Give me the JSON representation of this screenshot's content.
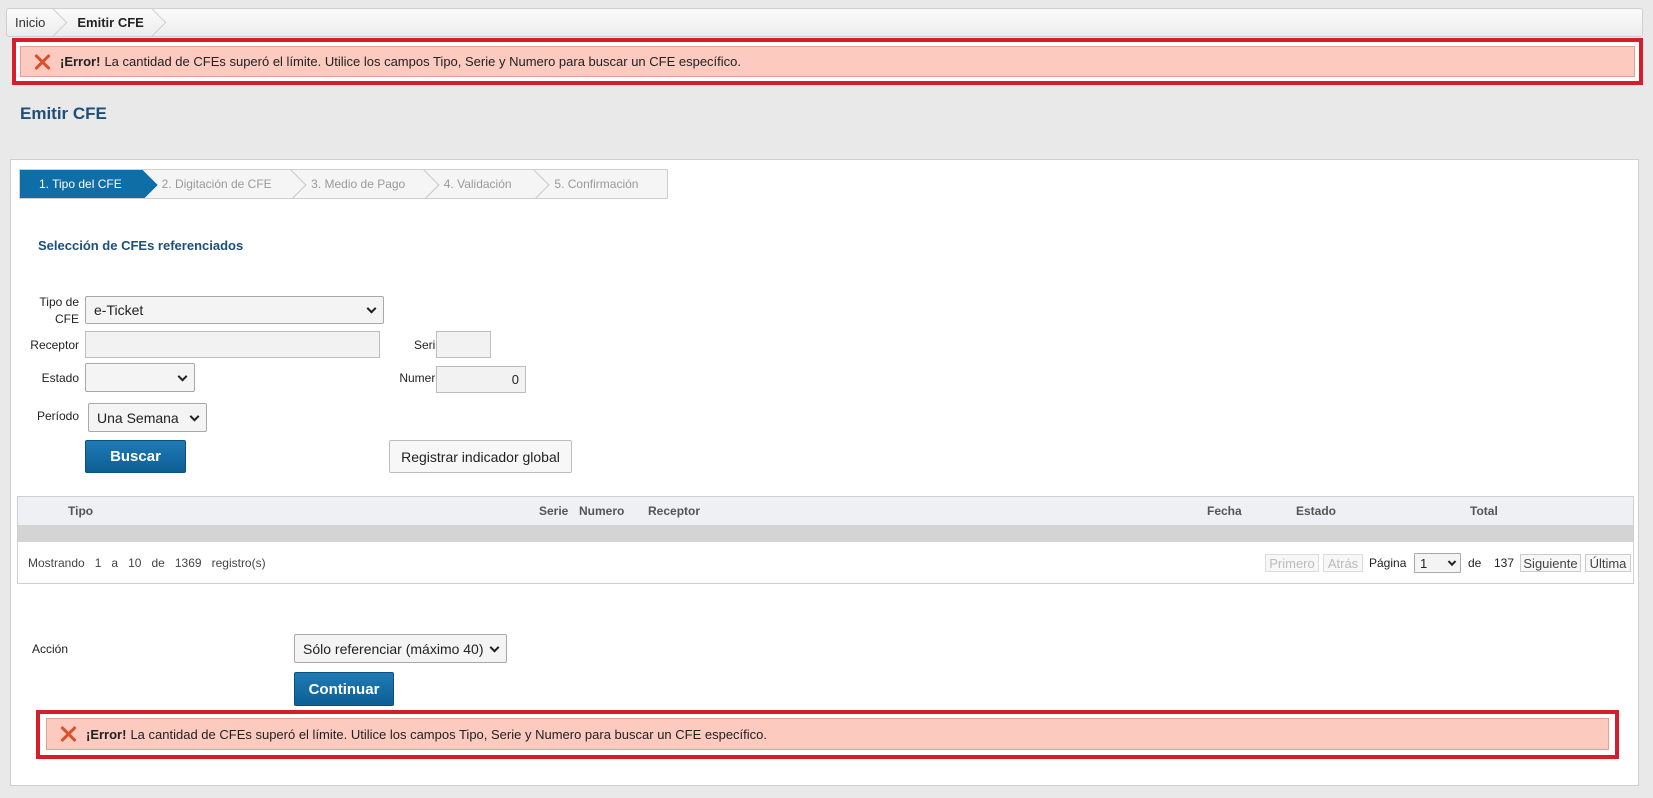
{
  "breadcrumb": {
    "home": "Inicio",
    "current": "Emitir CFE"
  },
  "error": {
    "strong": "¡Error!",
    "message": "La cantidad de CFEs superó el límite. Utilice los campos Tipo, Serie y Numero para buscar un CFE específico."
  },
  "page_title": "Emitir CFE",
  "wizard": {
    "steps": [
      "1. Tipo del CFE",
      "2. Digitación de CFE",
      "3. Medio de Pago",
      "4. Validación",
      "5. Confirmación"
    ],
    "active_index": 0
  },
  "section_title": "Selección de CFEs referenciados",
  "form": {
    "tipo_cfe_label": "Tipo de CFE",
    "tipo_cfe_value": "e-Ticket",
    "receptor_label": "Receptor",
    "receptor_value": "",
    "serie_label": "Serie",
    "serie_value": "",
    "estado_label": "Estado",
    "estado_value": "",
    "numero_label": "Numero",
    "numero_value": "0",
    "periodo_label": "Período",
    "periodo_value": "Una Semana",
    "buscar_label": "Buscar",
    "registrar_label": "Registrar indicador global"
  },
  "table": {
    "columns": [
      "Tipo",
      "Serie",
      "Numero",
      "Receptor",
      "Fecha",
      "Estado",
      "Total"
    ],
    "footer": {
      "mostrando": "Mostrando",
      "from": "1",
      "a": "a",
      "to": "10",
      "de": "de",
      "total": "1369",
      "registros": "registro(s)"
    },
    "pager": {
      "primero": "Primero",
      "atras": "Atrás",
      "pagina_label": "Página",
      "page_value": "1",
      "de_label": "de",
      "page_total": "137",
      "siguiente": "Siguiente",
      "ultima": "Última"
    }
  },
  "accion": {
    "label": "Acción",
    "value": "Sólo referenciar (máximo 40)",
    "continuar_label": "Continuar"
  },
  "colors": {
    "brand_blue": "#0f6ea6",
    "title_blue": "#1d4f7a",
    "error_border": "#d71c2a",
    "error_bg": "#fccabf"
  }
}
